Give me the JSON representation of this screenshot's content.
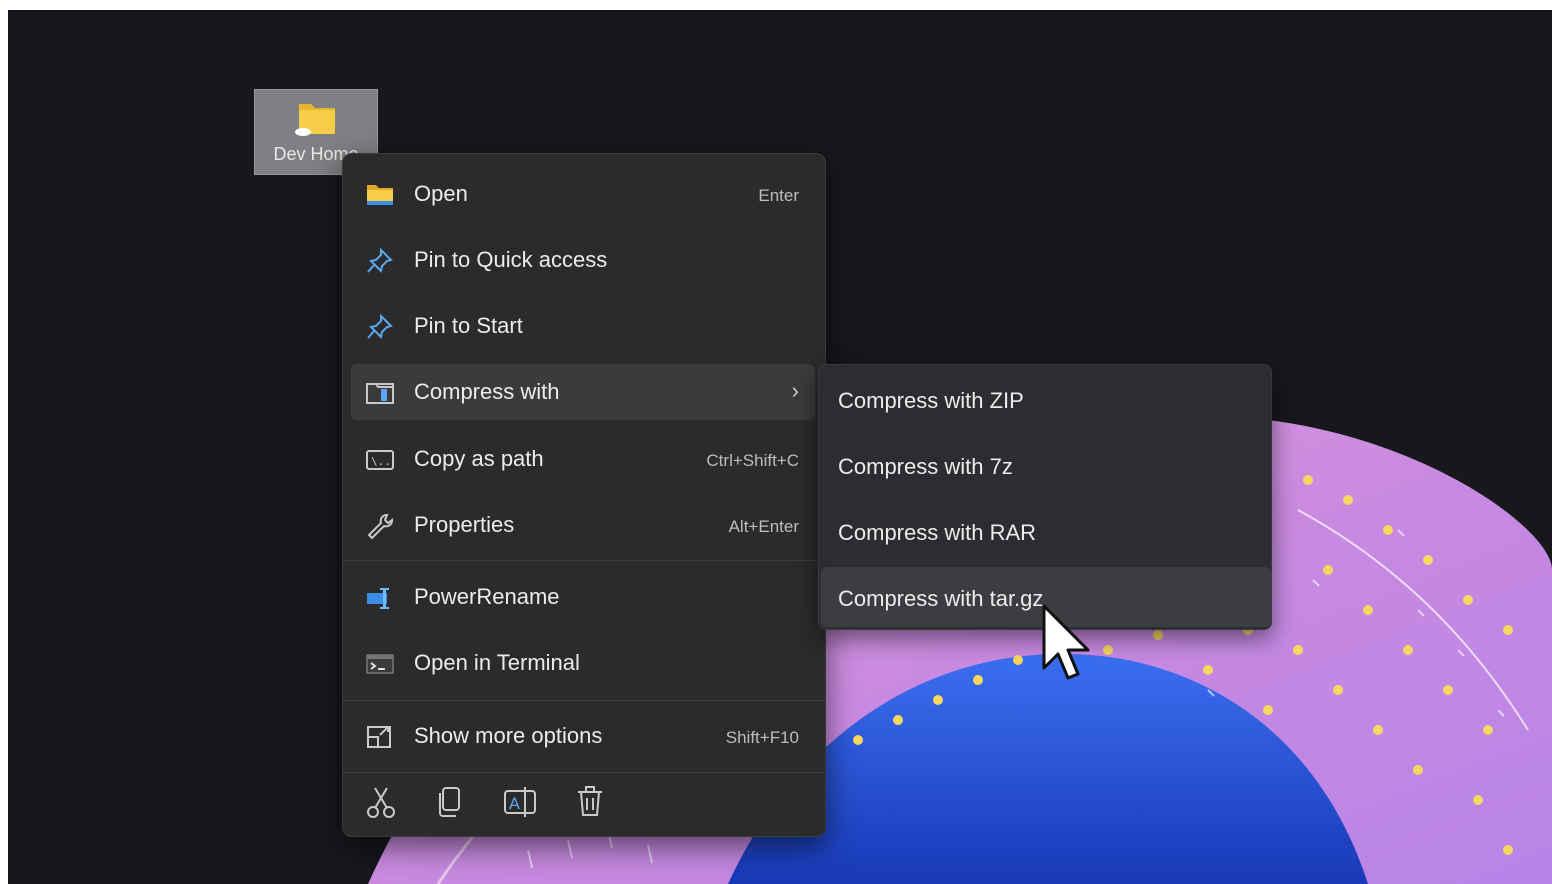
{
  "desktop": {
    "icon_label": "Dev Home"
  },
  "context_menu": {
    "items": [
      {
        "label": "Open",
        "shortcut": "Enter",
        "icon": "folder-icon"
      },
      {
        "label": "Pin to Quick access",
        "shortcut": "",
        "icon": "pin-icon"
      },
      {
        "label": "Pin to Start",
        "shortcut": "",
        "icon": "pin-icon"
      },
      {
        "label": "Compress with",
        "shortcut": "",
        "icon": "archive-icon",
        "has_submenu": true
      },
      {
        "label": "Copy as path",
        "shortcut": "Ctrl+Shift+C",
        "icon": "path-icon"
      },
      {
        "label": "Properties",
        "shortcut": "Alt+Enter",
        "icon": "wrench-icon"
      },
      {
        "label": "PowerRename",
        "shortcut": "",
        "icon": "powerrename-icon"
      },
      {
        "label": "Open in Terminal",
        "shortcut": "",
        "icon": "terminal-icon"
      },
      {
        "label": "Show more options",
        "shortcut": "Shift+F10",
        "icon": "expand-icon"
      }
    ],
    "quick_actions": [
      "cut-icon",
      "copy-icon",
      "rename-icon",
      "delete-icon"
    ],
    "chevron": "›"
  },
  "submenu": {
    "items": [
      {
        "label": "Compress with ZIP"
      },
      {
        "label": "Compress with 7z"
      },
      {
        "label": "Compress with RAR"
      },
      {
        "label": "Compress with tar.gz"
      }
    ]
  },
  "colors": {
    "desktop_bg": "#17181c",
    "menu_bg": "#2b2b2c",
    "hover_bg": "#3b3b3d",
    "accent_blue": "#3a8ee6",
    "folder_yellow": "#f3c13a"
  }
}
